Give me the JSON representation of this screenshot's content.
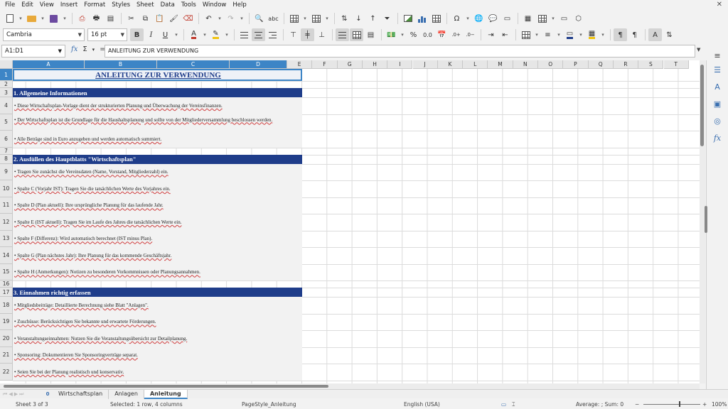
{
  "menu": [
    "File",
    "Edit",
    "View",
    "Insert",
    "Format",
    "Styles",
    "Sheet",
    "Data",
    "Tools",
    "Window",
    "Help"
  ],
  "font": {
    "name": "Cambria",
    "size": "16 pt"
  },
  "formula": {
    "namebox": "A1:D1",
    "content": "ANLEITUNG ZUR VERWENDUNG"
  },
  "columns": [
    "A",
    "B",
    "C",
    "D",
    "E",
    "F",
    "G",
    "H",
    "I",
    "J",
    "K",
    "L",
    "M",
    "N",
    "O",
    "P",
    "Q",
    "R",
    "S",
    "T"
  ],
  "rows": [
    {
      "num": "1",
      "type": "title",
      "text": "ANLEITUNG ZUR VERWENDUNG"
    },
    {
      "num": "2",
      "type": "blank",
      "text": ""
    },
    {
      "num": "3",
      "type": "section",
      "text": "1. Allgemeine Informationen"
    },
    {
      "num": "4",
      "type": "item",
      "text": "• Diese Wirtschaftsplan-Vorlage dient der strukturierten Planung und Überwachung der Vereinsfinanzen."
    },
    {
      "num": "5",
      "type": "wrap",
      "text": "• Der Wirtschaftsplan ist die Grundlage für die Haushaltsplanung und sollte von der Mitgliederversammlung beschlossen werden."
    },
    {
      "num": "6",
      "type": "item",
      "text": "• Alle Beträge sind in Euro anzugeben und werden automatisch summiert."
    },
    {
      "num": "7",
      "type": "blank",
      "text": ""
    },
    {
      "num": "8",
      "type": "section",
      "text": "2. Ausfüllen des Hauptblatts \"Wirtschaftsplan\""
    },
    {
      "num": "9",
      "type": "item",
      "text": "• Tragen Sie zunächst die Vereinsdaten (Name, Vorstand, Mitgliederzahl) ein."
    },
    {
      "num": "10",
      "type": "item",
      "text": "• Spalte C (Vorjahr IST): Tragen Sie die tatsächlichen Werte des Vorjahres ein."
    },
    {
      "num": "11",
      "type": "item",
      "text": "• Spalte D (Plan aktuell): Ihre ursprüngliche Planung für das laufende Jahr."
    },
    {
      "num": "12",
      "type": "item",
      "text": "• Spalte E (IST aktuell): Tragen Sie im Laufe des Jahres die tatsächlichen Werte ein."
    },
    {
      "num": "13",
      "type": "item",
      "text": "• Spalte F (Differenz): Wird automatisch berechnet (IST minus Plan)."
    },
    {
      "num": "14",
      "type": "item",
      "text": "• Spalte G (Plan nächstes Jahr): Ihre Planung für das kommende Geschäftsjahr."
    },
    {
      "num": "15",
      "type": "item",
      "text": "• Spalte H (Anmerkungen): Notizen zu besonderen Vorkommnissen oder Planungsannahmen."
    },
    {
      "num": "16",
      "type": "blank",
      "text": ""
    },
    {
      "num": "17",
      "type": "section",
      "text": "3. Einnahmen richtig erfassen"
    },
    {
      "num": "18",
      "type": "item",
      "text": "• Mitgliedsbeiträge: Detaillierte Berechnung siehe Blatt \"Anlagen\"."
    },
    {
      "num": "19",
      "type": "item",
      "text": "• Zuschüsse: Berücksichtigen Sie bekannte und erwartete Förderungen."
    },
    {
      "num": "20",
      "type": "item",
      "text": "• Veranstaltungseinnahmen: Nutzen Sie die Veranstaltungsübersicht zur Detailplanung."
    },
    {
      "num": "21",
      "type": "item",
      "text": "• Sponsoring: Dokumentieren Sie Sponsoringverträge separat."
    },
    {
      "num": "22",
      "type": "item",
      "text": "• Seien Sie bei der Planung realistisch und konservativ."
    }
  ],
  "tabs": {
    "add": "0",
    "items": [
      "Wirtschaftsplan",
      "Anlagen",
      "Anleitung"
    ],
    "active": 2
  },
  "status": {
    "sheet": "Sheet 3 of 3",
    "selection": "Selected: 1 row, 4 columns",
    "pagestyle": "PageStyle_Anleitung",
    "language": "English (USA)",
    "summary": "Average: ; Sum: 0",
    "zoom": "100%"
  }
}
